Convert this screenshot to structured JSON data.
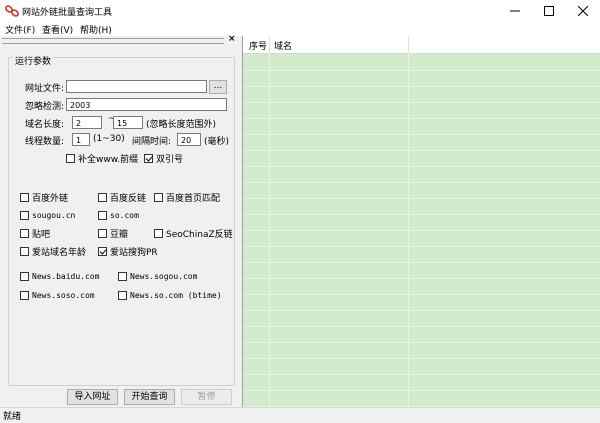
{
  "window": {
    "title": "网站外链批量查询工具",
    "minimize_glyph": "—",
    "maximize_glyph": "☐",
    "close_glyph": "✕"
  },
  "menu": [
    "文件(F)",
    "查看(V)",
    "帮助(H)"
  ],
  "panel": {
    "close_glyph": "×",
    "group_title": "运行参数",
    "url_file_label": "网址文件:",
    "url_file_value": "",
    "browse_label": "...",
    "ignore_label": "忽略检测:",
    "ignore_value": "2003",
    "domain_len_label": "域名长度:",
    "domain_len_min": "2",
    "tilde": "~",
    "domain_len_max": "15",
    "domain_len_note": "(忽略长度范围外)",
    "threads_label": "线程数量:",
    "threads_value": "1",
    "threads_range": "(1~30)",
    "interval_label": "间隔时间:",
    "interval_value": "20",
    "interval_unit": "(毫秒)",
    "opt_www": {
      "label": "补全www.前缀",
      "checked": false
    },
    "opt_quote": {
      "label": "双引号",
      "checked": true
    },
    "checks": [
      {
        "label": "百度外链",
        "checked": false
      },
      {
        "label": "百度反链",
        "checked": false
      },
      {
        "label": "百度首页匹配",
        "checked": false
      },
      {
        "label": "sougou.cn",
        "checked": false
      },
      {
        "label": "so.com",
        "checked": false
      },
      {
        "label": "贴吧",
        "checked": false
      },
      {
        "label": "豆瓣",
        "checked": false
      },
      {
        "label": "SeoChinaZ反链",
        "checked": false
      },
      {
        "label": "爱站域名年龄",
        "checked": false
      },
      {
        "label": "爱站搜狗PR",
        "checked": true
      },
      {
        "label": "News.baidu.com",
        "checked": false
      },
      {
        "label": "News.sogou.com",
        "checked": false
      },
      {
        "label": "News.soso.com",
        "checked": false
      },
      {
        "label": "News.so.com (btime)",
        "checked": false
      }
    ],
    "import_button": "导入网址",
    "start_button": "开始查询",
    "pause_button": "暂停"
  },
  "grid": {
    "columns": [
      "序号",
      "域名"
    ],
    "row_color": "#d1ebcc"
  },
  "status": {
    "text": "就绪"
  }
}
